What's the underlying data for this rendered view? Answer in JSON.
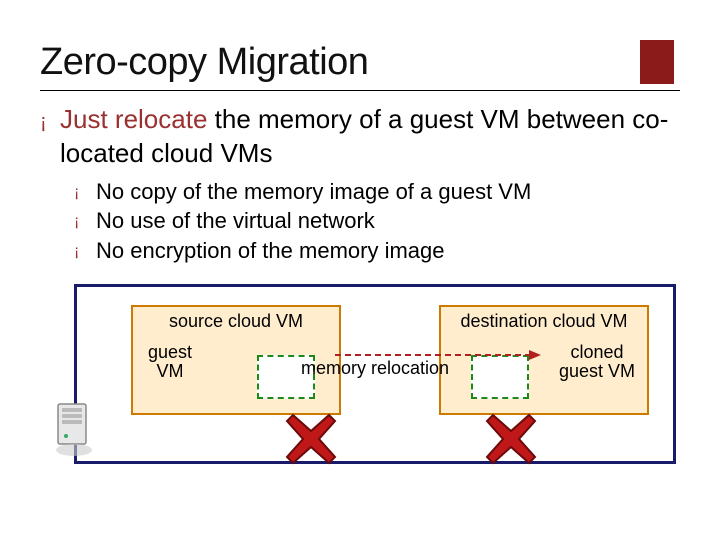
{
  "title": "Zero-copy Migration",
  "bullets": {
    "main_emph": "Just relocate",
    "main_rest": " the memory of a guest VM between co-located cloud VMs",
    "subs": [
      "No copy of the memory image of a guest VM",
      "No use of the virtual network",
      "No encryption of the memory image"
    ]
  },
  "diagram": {
    "source_label": "source cloud VM",
    "dest_label": "destination cloud VM",
    "guest_label": "guest VM",
    "cloned_label": "cloned guest VM",
    "arrow_label": "memory relocation"
  },
  "glyphs": {
    "bullet1": "¡",
    "bullet2": "¡"
  },
  "colors": {
    "accent": "#8b1a1a",
    "frame": "#1a1a6a",
    "vm_border": "#cc7a00",
    "vm_fill": "#ffedce",
    "mem_border": "#1a8a1a"
  }
}
